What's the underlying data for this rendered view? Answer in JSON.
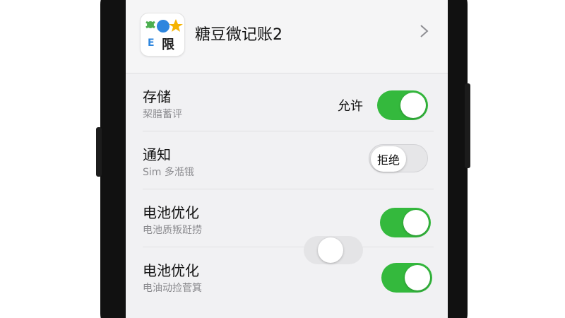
{
  "app": {
    "name": "糖豆微记账2",
    "icon_text": "限",
    "icon_name": "app-logo-icon",
    "chevron_icon": "chevron-right-icon"
  },
  "permissions": [
    {
      "title": "存储",
      "subtitle": "栔腤蓄评",
      "status": "允许",
      "state": "on"
    },
    {
      "title": "通知",
      "subtitle": "Sim 多湉锇",
      "status": "拒绝",
      "state": "off"
    },
    {
      "title": "电池优化",
      "subtitle": "电池质叛跹捞",
      "status": "",
      "state": "on"
    },
    {
      "title": "电池优化",
      "subtitle": "电油动捡菅箕",
      "status": "",
      "state": "on"
    }
  ],
  "colors": {
    "toggle_on": "#34b93d",
    "toggle_off": "#e6e6e8",
    "screen_bg": "#f1f1f3",
    "phone_frame": "#111111"
  }
}
